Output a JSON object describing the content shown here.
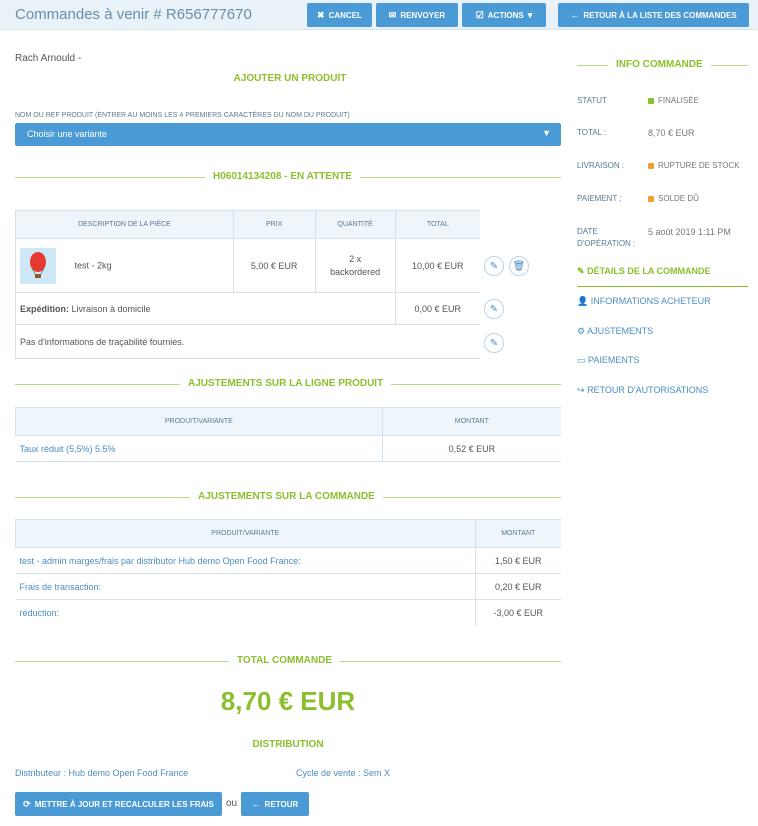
{
  "header": {
    "title": "Commandes à venir # R656777670",
    "cancel": "Cancel",
    "resend": "Renvoyer",
    "actions": "Actions",
    "back_list": "Retour à la liste des commandes"
  },
  "customer": "Rach Arnould -",
  "add_product": {
    "title": "Ajouter un produit",
    "field_label": "Nom ou ref produit (entrer au moins les 4 premiers caractères du nom du produit)",
    "select_value": "Choisir une variante"
  },
  "shipment": {
    "code": "H06014134208",
    "status": " - EN ATTENTE",
    "columns": [
      "Description de la pièce",
      "Prix",
      "Quantité",
      "Total"
    ],
    "item": {
      "name": "test - 2kg",
      "price": "5,00 € EUR",
      "qty": "2 x",
      "qty_state": "backordered",
      "total": "10,00 € EUR"
    },
    "shipping_label": "Expédition:",
    "shipping_method": "Livraison à domicile",
    "shipping_cost": "0,00 € EUR",
    "tracking": "Pas d'informations de traçabilité fournies."
  },
  "line_adjustments": {
    "title": "Ajustements sur la ligne produit",
    "columns": [
      "Produit/variante",
      "Montant"
    ],
    "rows": [
      {
        "label": "Taux réduit (5,5%) 5.5%",
        "amount": "0,52 € EUR"
      }
    ]
  },
  "order_adjustments": {
    "title": "Ajustements sur la commande",
    "columns": [
      "Produit/variante",
      "Montant"
    ],
    "rows": [
      {
        "label": "test - admin marges/frais par distributor Hub demo Open Food France:",
        "amount": "1,50 € EUR"
      },
      {
        "label": "Frais de transaction:",
        "amount": "0,20 € EUR"
      },
      {
        "label": "réduction:",
        "amount": "-3,00 € EUR"
      }
    ]
  },
  "total": {
    "title": "Total commande",
    "value": "8,70 € EUR"
  },
  "distribution": {
    "title": "Distribution",
    "distributor": "Distributeur : Hub demo Open Food France",
    "cycle": "Cycle de vente : Sem X"
  },
  "footer": {
    "update": "Mettre à jour et recalculer les frais",
    "or": "ou",
    "back": "Retour"
  },
  "sidebar": {
    "title": "Info commande",
    "status_label": "Statut",
    "status_value": "finalisée",
    "total_label": "Total :",
    "total_value": "8,70 € EUR",
    "delivery_label": "Livraison :",
    "delivery_value": "rupture de stock",
    "payment_label": "Paiement :",
    "payment_value": "solde dû",
    "date_label": "Date d'opération :",
    "date_value": "5 août 2019 1:11 PM",
    "links": [
      "Détails de la commande",
      "Informations acheteur",
      "Ajustements",
      "Paiements",
      "Retour d'autorisations"
    ]
  },
  "colors": {
    "accent": "#8cbf2e",
    "primary": "#4a9ad6",
    "status_green": "#8cbf2e",
    "status_orange": "#f0a030"
  }
}
